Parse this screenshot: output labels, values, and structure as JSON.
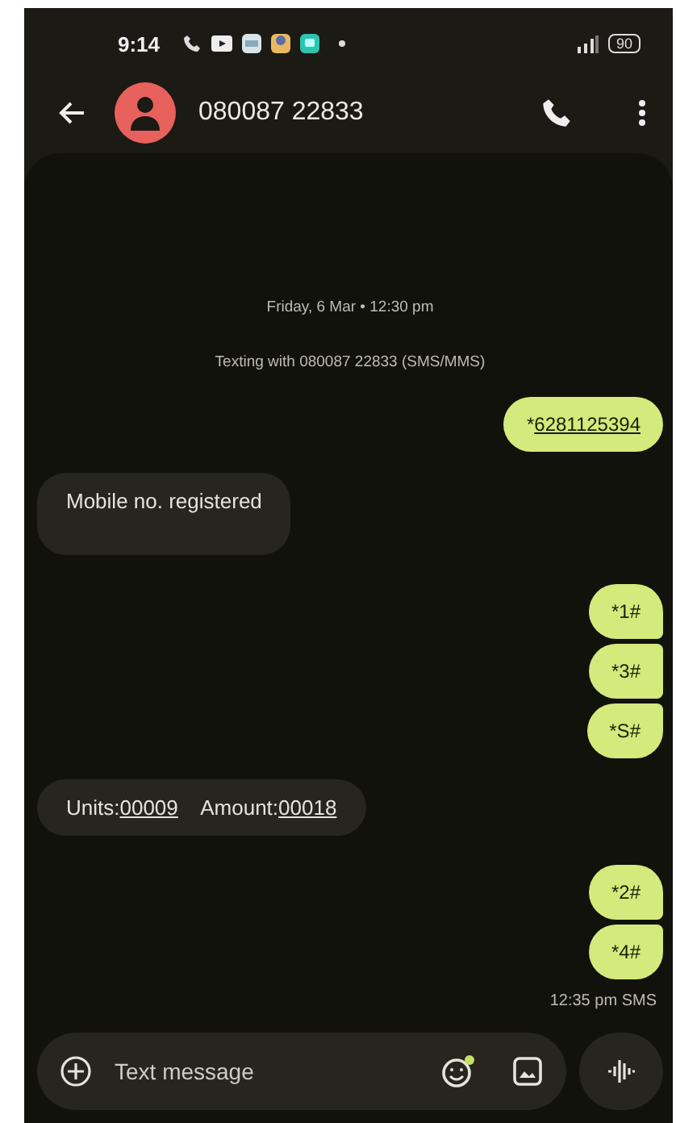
{
  "status_bar": {
    "time": "9:14",
    "battery": "90"
  },
  "header": {
    "contact": "080087 22833"
  },
  "conversation": {
    "date": "Friday, 6 Mar • 12:30 pm",
    "info": "Texting with 080087 22833 (SMS/MMS)",
    "messages": [
      {
        "kind": "outgoing",
        "parts": [
          {
            "text": "*",
            "link": false
          },
          {
            "text": "6281125394",
            "link": true
          }
        ]
      },
      {
        "kind": "incoming",
        "parts": [
          {
            "text": "Mobile no. registered",
            "link": false
          }
        ]
      },
      {
        "kind": "outgoing",
        "parts": [
          {
            "text": "*1#",
            "link": false
          }
        ]
      },
      {
        "kind": "outgoing",
        "parts": [
          {
            "text": "*3#",
            "link": false
          }
        ]
      },
      {
        "kind": "outgoing",
        "parts": [
          {
            "text": "*S#",
            "link": false
          }
        ]
      },
      {
        "kind": "incoming",
        "parts": [
          {
            "text": "Units:",
            "link": false
          },
          {
            "text": "00009",
            "link": true
          },
          {
            "text": "    Amount:",
            "link": false
          },
          {
            "text": "00018",
            "link": true
          }
        ]
      },
      {
        "kind": "outgoing",
        "parts": [
          {
            "text": "*2#",
            "link": false
          }
        ]
      },
      {
        "kind": "outgoing",
        "parts": [
          {
            "text": "*4#",
            "link": false
          }
        ]
      }
    ],
    "timestamp": "12:35 pm  SMS"
  },
  "composer": {
    "placeholder": "Text message"
  }
}
